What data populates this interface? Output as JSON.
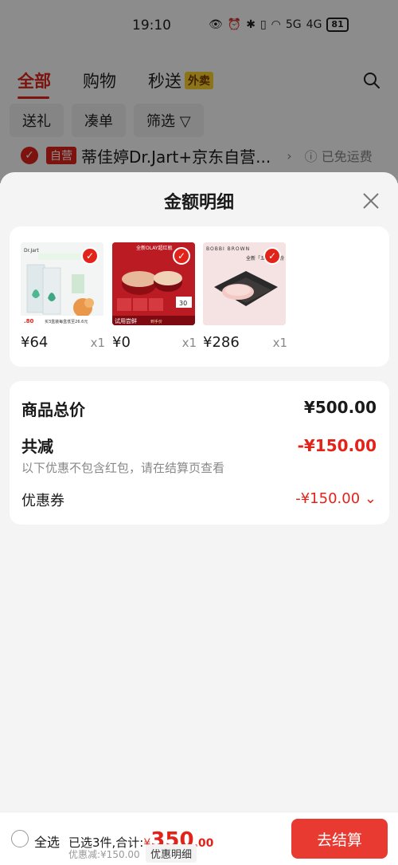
{
  "status_bar": {
    "time": "19:10",
    "net_a": "5G",
    "net_b": "4G",
    "battery": "81"
  },
  "tabs": [
    {
      "label": "全部"
    },
    {
      "label": "购物"
    },
    {
      "label": "秒送",
      "badge": "外卖"
    }
  ],
  "filters": [
    "送礼",
    "凑单",
    "筛选"
  ],
  "shop": {
    "self_label": "自营",
    "name": "蒂佳婷Dr.Jart+京东自营...",
    "shipping": "已免运费"
  },
  "sheet": {
    "title": "金额明细"
  },
  "products": [
    {
      "price": "¥64",
      "qty": "x1"
    },
    {
      "price": "¥0",
      "qty": "x1"
    },
    {
      "price": "¥286",
      "qty": "x1"
    }
  ],
  "product_texts": {
    "p1_brand": "Dr.Jart",
    "p1_promo": "买3盒装每盒低至26.6元",
    "p1_price_tag": ".80",
    "p2_title": "全新OLAY超红瓶",
    "p2_tag": "试用尝鲜",
    "p2_note": "到手价",
    "p2_num": "30",
    "p3_brand": "BOBBI BROWN",
    "p3_title": "全新「五花肉」粉"
  },
  "summary": {
    "total_label": "商品总价",
    "total_value": "¥500.00",
    "discount_label": "共减",
    "discount_value": "-¥150.00",
    "note": "以下优惠不包含红包，请在结算页查看",
    "coupon_label": "优惠券",
    "coupon_value": "-¥150.00"
  },
  "bottom_bar": {
    "select_all": "全选",
    "selected_prefix": "已选3件,合计:",
    "currency": "¥",
    "total_int": "350",
    "total_dec": ".00",
    "discount_info": "优惠减:¥150.00",
    "detail_link": "优惠明细",
    "checkout": "去结算"
  },
  "colors": {
    "accent": "#e2231a",
    "checkout": "#e93a32",
    "badge": "#ffd52e"
  }
}
